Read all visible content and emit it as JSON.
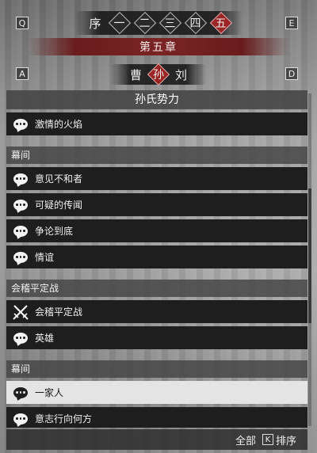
{
  "chapter_nav": {
    "prev_key": "Q",
    "next_key": "E",
    "items": [
      {
        "label": "序",
        "style": "plain"
      },
      {
        "label": "一",
        "style": "diamond"
      },
      {
        "label": "二",
        "style": "diamond"
      },
      {
        "label": "三",
        "style": "diamond"
      },
      {
        "label": "四",
        "style": "diamond"
      },
      {
        "label": "五",
        "style": "diamond",
        "active": true
      }
    ],
    "title": "第五章"
  },
  "faction_nav": {
    "prev_key": "A",
    "next_key": "D",
    "items": [
      {
        "label": "曹",
        "style": "plain"
      },
      {
        "label": "孙",
        "style": "diamond",
        "active": true
      },
      {
        "label": "刘",
        "style": "plain"
      }
    ]
  },
  "list": {
    "faction_title": "孙氏势力",
    "sections": [
      {
        "header": "",
        "items": [
          {
            "label": "激情的火焰",
            "icon": "speech-bubble-icon"
          }
        ]
      },
      {
        "header": "幕间",
        "items": [
          {
            "label": "意见不和者",
            "icon": "speech-bubble-icon"
          },
          {
            "label": "可疑的传闻",
            "icon": "speech-bubble-icon"
          },
          {
            "label": "争论到底",
            "icon": "speech-bubble-icon"
          },
          {
            "label": "情谊",
            "icon": "speech-bubble-icon"
          }
        ]
      },
      {
        "header": "会稽平定战",
        "items": [
          {
            "label": "会稽平定战",
            "icon": "crossed-swords-icon"
          },
          {
            "label": "英雄",
            "icon": "speech-bubble-icon"
          }
        ]
      },
      {
        "header": "幕间",
        "items": [
          {
            "label": "一家人",
            "icon": "speech-bubble-icon",
            "selected": true
          },
          {
            "label": "意志行向何方",
            "icon": "speech-bubble-icon"
          }
        ]
      }
    ]
  },
  "footer": {
    "all_label": "全部",
    "sort_key": "K",
    "sort_label": "排序"
  },
  "colors": {
    "accent_red": "#9b2424",
    "item_dark": "#1e1e1e",
    "item_selected": "#e4e4e4"
  }
}
